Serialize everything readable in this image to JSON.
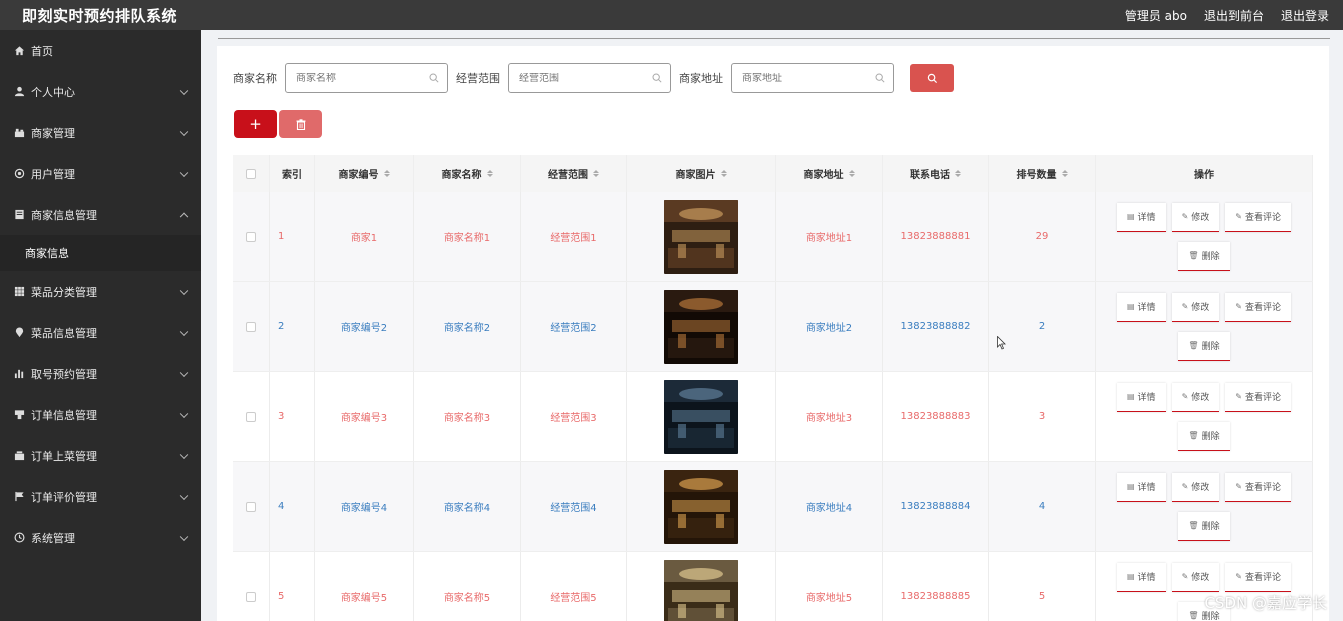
{
  "header": {
    "title": "即刻实时预约排队系统",
    "admin": "管理员 abo",
    "front": "退出到前台",
    "logout": "退出登录"
  },
  "sidebar": {
    "items": [
      {
        "label": "首页",
        "icon": "home-icon"
      },
      {
        "label": "个人中心",
        "icon": "user-icon"
      },
      {
        "label": "商家管理",
        "icon": "shop-icon"
      },
      {
        "label": "用户管理",
        "icon": "users-icon"
      },
      {
        "label": "商家信息管理",
        "icon": "info-icon"
      },
      {
        "label": "菜品分类管理",
        "icon": "grid-icon"
      },
      {
        "label": "菜品信息管理",
        "icon": "location-icon"
      },
      {
        "label": "取号预约管理",
        "icon": "bar-chart-icon"
      },
      {
        "label": "订单信息管理",
        "icon": "cup-icon"
      },
      {
        "label": "订单上菜管理",
        "icon": "tray-icon"
      },
      {
        "label": "订单评价管理",
        "icon": "flag-icon"
      },
      {
        "label": "系统管理",
        "icon": "clock-icon"
      }
    ],
    "submenu": "商家信息"
  },
  "search": {
    "label1": "商家名称",
    "placeholder1": "商家名称",
    "label2": "经营范围",
    "placeholder2": "经营范围",
    "label3": "商家地址",
    "placeholder3": "商家地址"
  },
  "actions": {
    "add": "+"
  },
  "table": {
    "headers": [
      "索引",
      "商家编号",
      "商家名称",
      "经营范围",
      "商家图片",
      "商家地址",
      "联系电话",
      "排号数量",
      "操作"
    ],
    "ops": {
      "detail": "详情",
      "edit": "修改",
      "review": "查看评论",
      "delete": "删除"
    },
    "rows": [
      {
        "index": "1",
        "code": "商家1",
        "name": "商家名称1",
        "scope": "经营范围1",
        "address": "商家地址1",
        "phone": "13823888881",
        "count": "29"
      },
      {
        "index": "2",
        "code": "商家编号2",
        "name": "商家名称2",
        "scope": "经营范围2",
        "address": "商家地址2",
        "phone": "13823888882",
        "count": "2"
      },
      {
        "index": "3",
        "code": "商家编号3",
        "name": "商家名称3",
        "scope": "经营范围3",
        "address": "商家地址3",
        "phone": "13823888883",
        "count": "3"
      },
      {
        "index": "4",
        "code": "商家编号4",
        "name": "商家名称4",
        "scope": "经营范围4",
        "address": "商家地址4",
        "phone": "13823888884",
        "count": "4"
      },
      {
        "index": "5",
        "code": "商家编号5",
        "name": "商家名称5",
        "scope": "经营范围5",
        "address": "商家地址5",
        "phone": "13823888885",
        "count": "5"
      }
    ]
  },
  "watermark": "CSDN @嘉应学长",
  "colors": {
    "accent": "#c8101a",
    "red_text": "#e86a6a",
    "blue_text": "#3a7dbf",
    "sidebar": "#2b2b2b",
    "header": "#3a3a3a"
  }
}
